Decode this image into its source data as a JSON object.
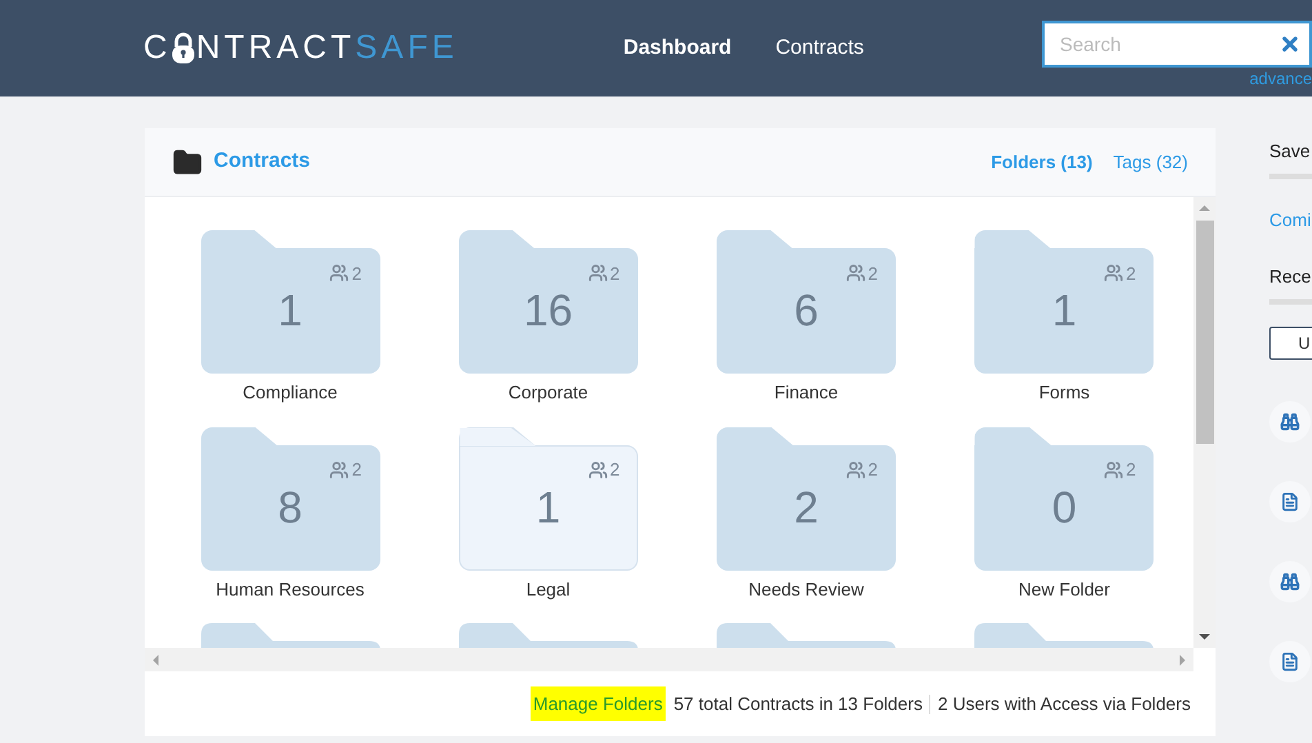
{
  "logo": {
    "before_lock": "C",
    "after_lock": "NTRACT",
    "accent": "SAFE"
  },
  "nav": [
    {
      "label": "Dashboard",
      "selected": true
    },
    {
      "label": "Contracts",
      "selected": false
    }
  ],
  "search": {
    "placeholder": "Search",
    "link": "advance"
  },
  "panel": {
    "title": "Contracts",
    "tabs": [
      {
        "label": "Folders (13)",
        "selected": true
      },
      {
        "label": "Tags (32)",
        "selected": false
      }
    ],
    "folders": [
      {
        "count": "1",
        "users": "2",
        "name": "Compliance",
        "selected": false
      },
      {
        "count": "16",
        "users": "2",
        "name": "Corporate",
        "selected": false
      },
      {
        "count": "6",
        "users": "2",
        "name": "Finance",
        "selected": false
      },
      {
        "count": "1",
        "users": "2",
        "name": "Forms",
        "selected": false
      },
      {
        "count": "8",
        "users": "2",
        "name": "Human Resources",
        "selected": false
      },
      {
        "count": "1",
        "users": "2",
        "name": "Legal",
        "selected": true
      },
      {
        "count": "2",
        "users": "2",
        "name": "Needs Review",
        "selected": false
      },
      {
        "count": "0",
        "users": "2",
        "name": "New Folder",
        "selected": false
      }
    ],
    "footer": {
      "link": "Manage Folders",
      "totals": "57 total Contracts in 13 Folders",
      "access": "2 Users with Access via Folders"
    }
  },
  "sidebar": {
    "saved_heading": "Save",
    "link": "Comi",
    "recent_heading": "Rece",
    "button": "U",
    "timeline": [
      {
        "kind": "search"
      },
      {
        "kind": "document"
      },
      {
        "kind": "search"
      },
      {
        "kind": "document"
      }
    ]
  }
}
